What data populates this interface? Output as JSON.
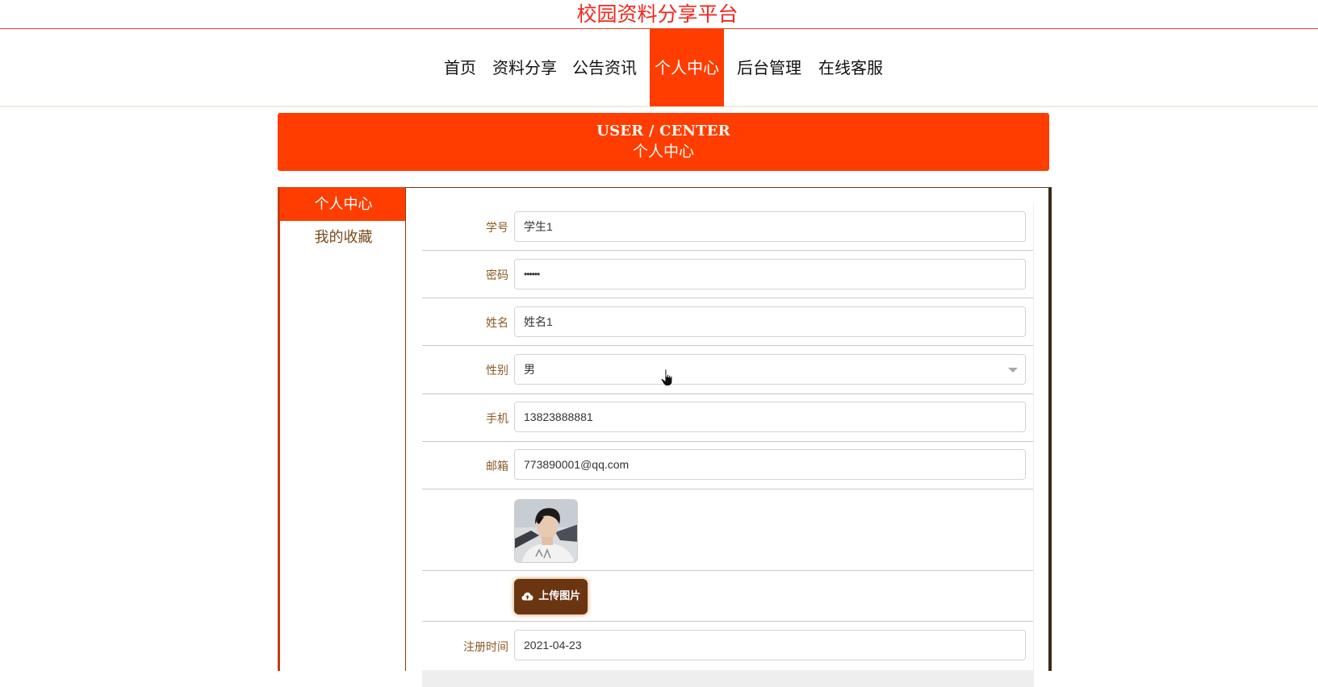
{
  "site": {
    "title": "校园资料分享平台"
  },
  "nav": {
    "items": [
      {
        "label": "首页",
        "active": false
      },
      {
        "label": "资料分享",
        "active": false
      },
      {
        "label": "公告资讯",
        "active": false
      },
      {
        "label": "个人中心",
        "active": true
      },
      {
        "label": "后台管理",
        "active": false
      },
      {
        "label": "在线客服",
        "active": false
      }
    ]
  },
  "banner": {
    "en": "USER / CENTER",
    "cn": "个人中心"
  },
  "sidebar": {
    "items": [
      {
        "label": "个人中心",
        "active": true
      },
      {
        "label": "我的收藏",
        "active": false
      }
    ]
  },
  "form": {
    "student_id": {
      "label": "学号",
      "value": "学生1"
    },
    "password": {
      "label": "密码",
      "value": "••••••"
    },
    "name": {
      "label": "姓名",
      "value": "姓名1"
    },
    "gender": {
      "label": "性别",
      "value": "男"
    },
    "phone": {
      "label": "手机",
      "value": "13823888881"
    },
    "email": {
      "label": "邮箱",
      "value": "773890001@qq.com"
    },
    "upload_button": "上传图片",
    "register_time": {
      "label": "注册时间",
      "value": "2021-04-23"
    }
  },
  "colors": {
    "accent": "#ff3d00",
    "title_red": "#f0291c",
    "label_brown": "#8a5a24",
    "upload_brown": "#6b3512"
  },
  "icons": {
    "upload": "cloud-upload-icon",
    "select": "chevron-down-icon",
    "cursor": "hand-cursor-icon"
  }
}
